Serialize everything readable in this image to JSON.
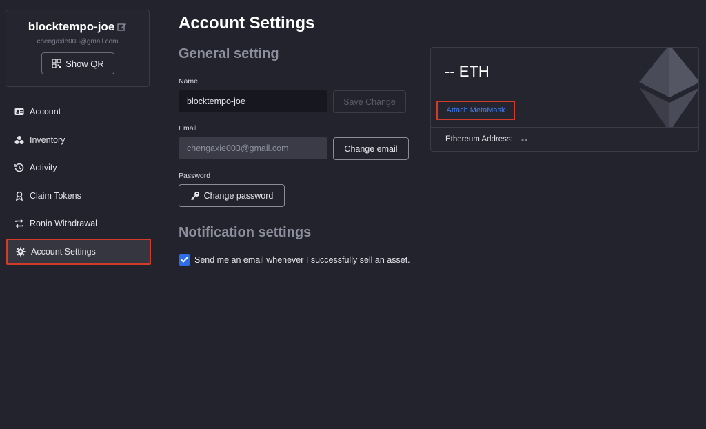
{
  "profile": {
    "username": "blocktempo-joe",
    "email": "chengaxie003@gmail.com",
    "show_qr_label": "Show QR"
  },
  "sidebar": {
    "items": [
      {
        "label": "Account",
        "icon": "id-card-icon"
      },
      {
        "label": "Inventory",
        "icon": "cubes-icon"
      },
      {
        "label": "Activity",
        "icon": "history-icon"
      },
      {
        "label": "Claim Tokens",
        "icon": "medal-icon"
      },
      {
        "label": "Ronin Withdrawal",
        "icon": "exchange-icon"
      },
      {
        "label": "Account Settings",
        "icon": "gear-icon",
        "active": true
      }
    ]
  },
  "main": {
    "title": "Account Settings",
    "general": {
      "title": "General setting",
      "name_label": "Name",
      "name_value": "blocktempo-joe",
      "save_label": "Save Change",
      "email_label": "Email",
      "email_value": "chengaxie003@gmail.com",
      "change_email_label": "Change email",
      "password_label": "Password",
      "change_password_label": "Change password"
    },
    "notification": {
      "title": "Notification settings",
      "checkbox_label": "Send me an email whenever I successfully sell an asset.",
      "checked": true
    }
  },
  "eth_card": {
    "balance": "-- ETH",
    "attach_label": "Attach MetaMask",
    "address_label": "Ethereum Address:",
    "address_value": "--"
  },
  "colors": {
    "background": "#22232d",
    "accent_blue": "#2d6ee8",
    "link_blue": "#3f7df0",
    "highlight_red": "#d23a2a"
  }
}
